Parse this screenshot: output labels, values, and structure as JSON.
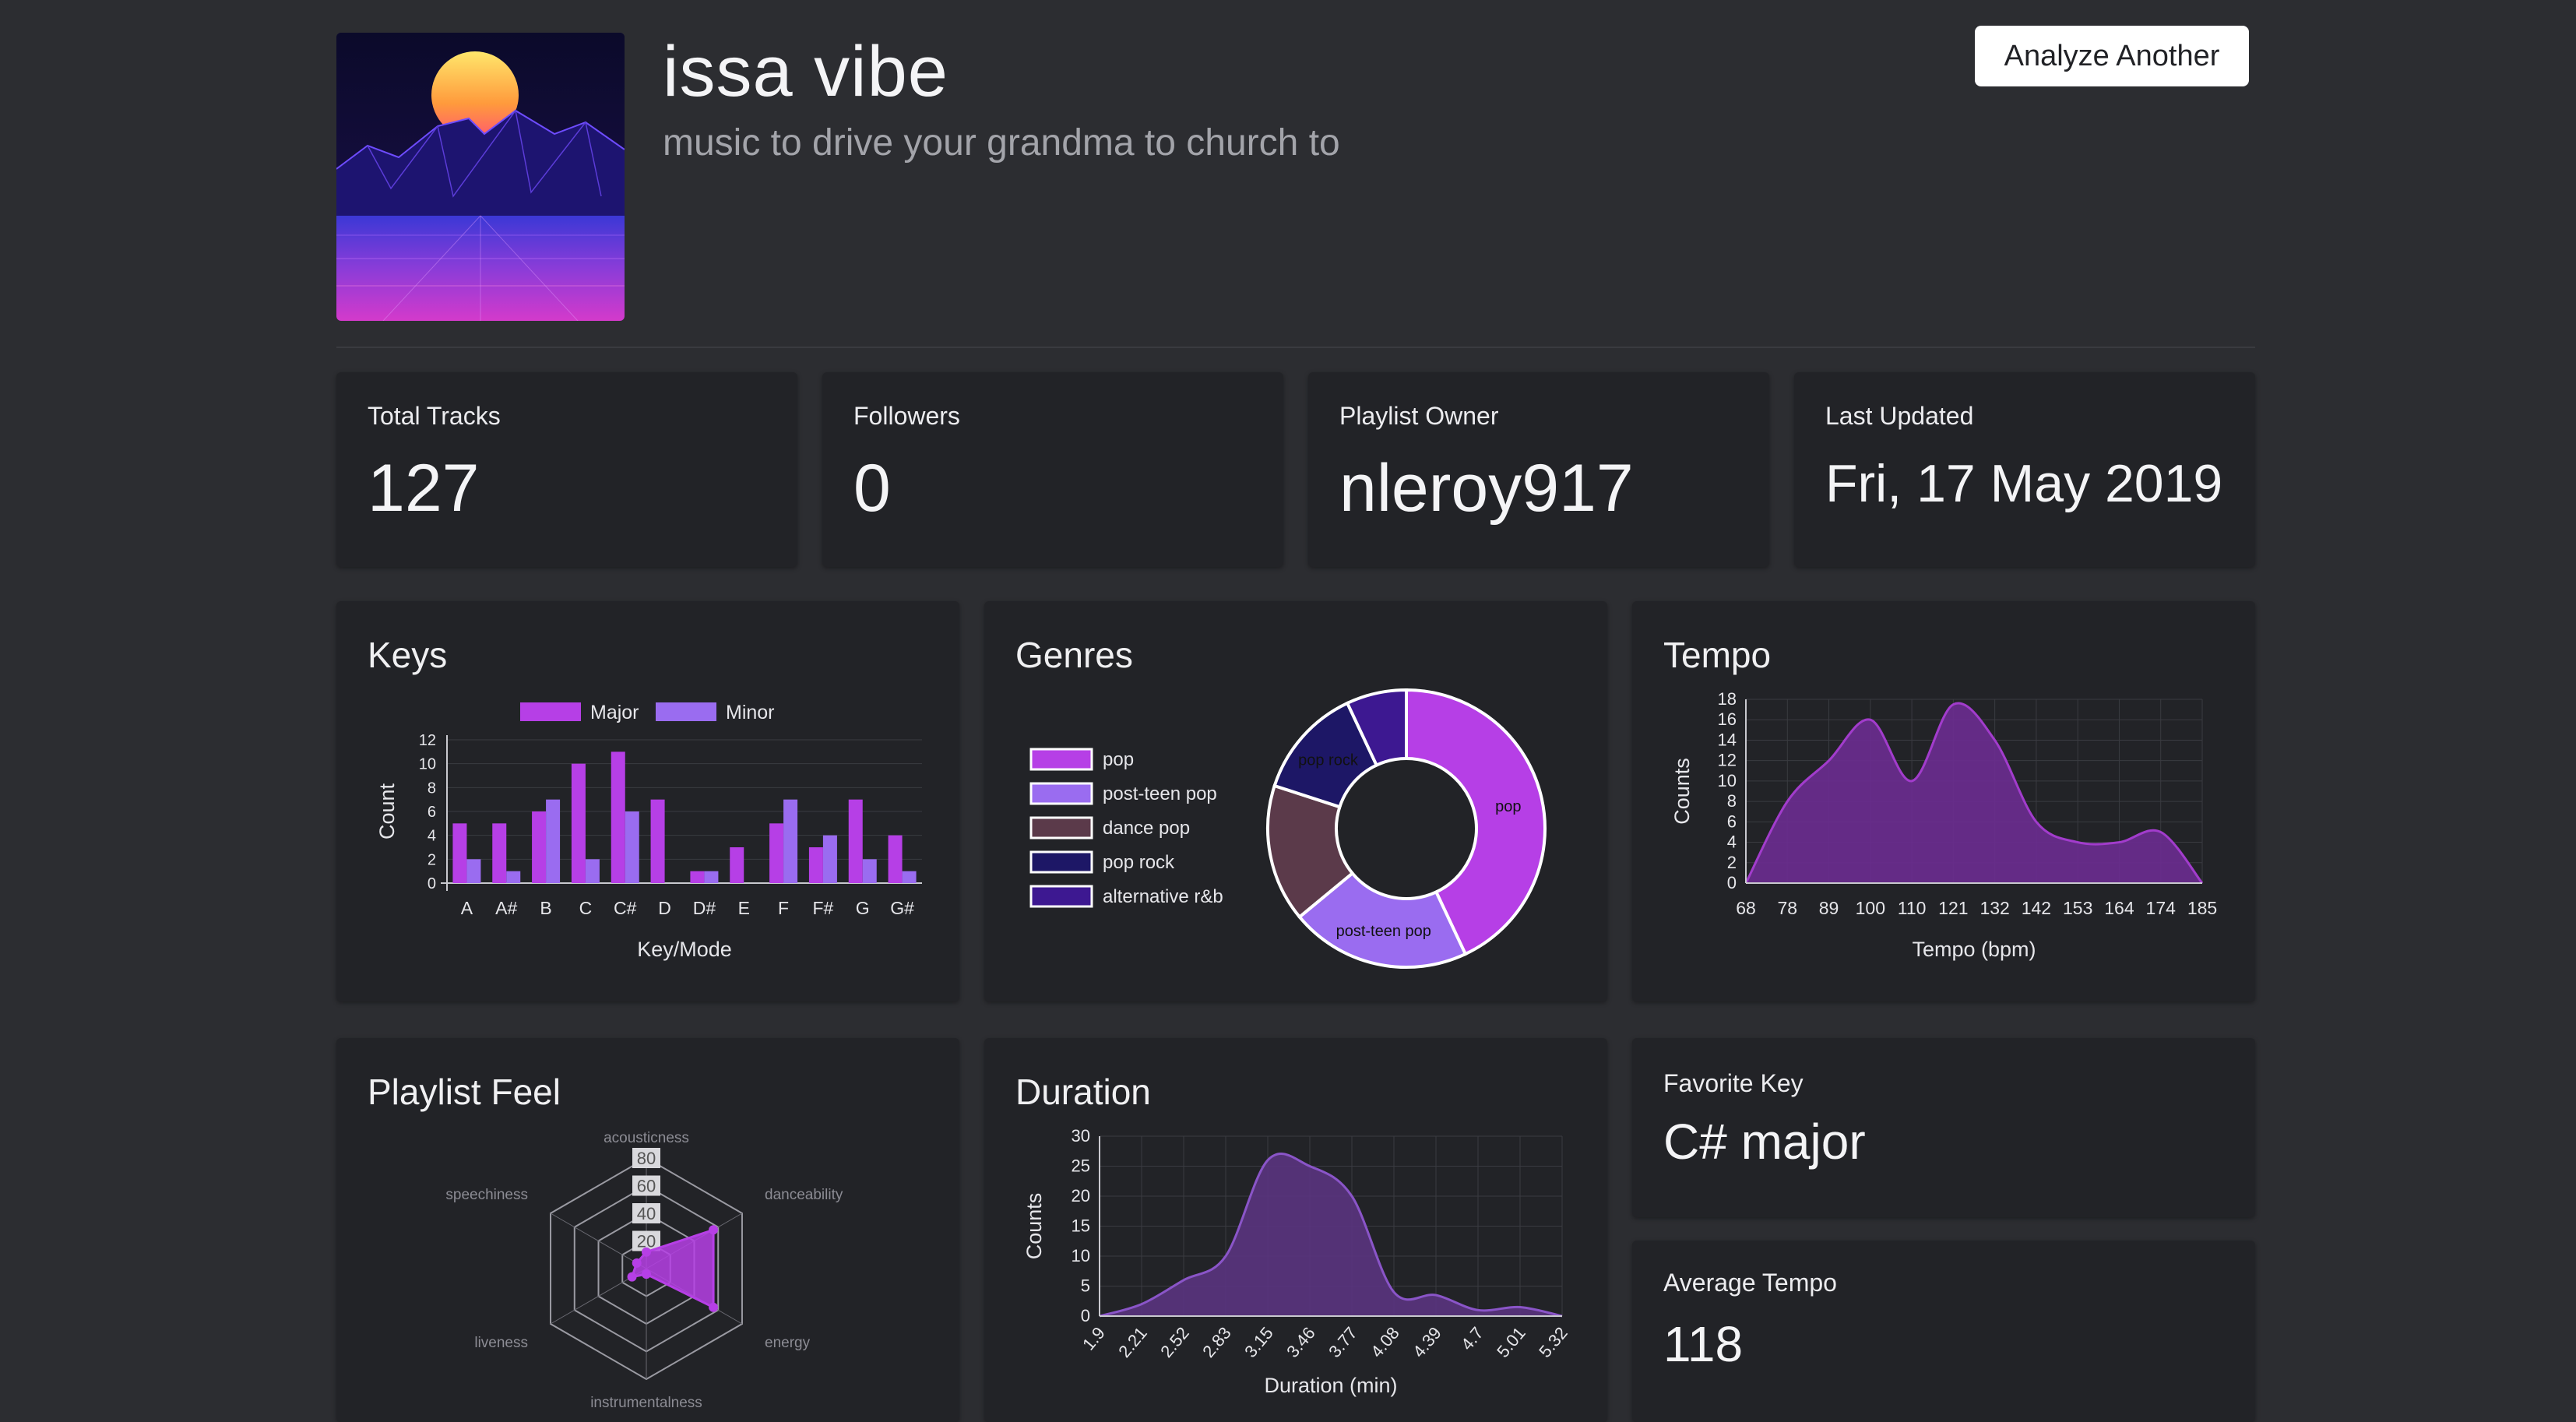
{
  "playlist": {
    "title": "issa vibe",
    "description": "music to drive your grandma to church to"
  },
  "header": {
    "analyze_label": "Analyze Another"
  },
  "stats": [
    {
      "label": "Total Tracks",
      "value": "127"
    },
    {
      "label": "Followers",
      "value": "0"
    },
    {
      "label": "Playlist Owner",
      "value": "nleroy917"
    },
    {
      "label": "Last Updated",
      "value": "Fri, 17 May 2019"
    }
  ],
  "cards": {
    "keys_title": "Keys",
    "genres_title": "Genres",
    "tempo_title": "Tempo",
    "feel_title": "Playlist Feel",
    "duration_title": "Duration"
  },
  "favorite_key": {
    "label": "Favorite Key",
    "value": "C# major"
  },
  "average_tempo": {
    "label": "Average Tempo",
    "value": "118"
  },
  "colors": {
    "major": "#b63fe6",
    "minor": "#9a6cf0",
    "area": "#6c2c91",
    "area_line": "#a23ccc",
    "duration_area": "#5a347f",
    "duration_line": "#8a55c8",
    "pop": "#b63fe6",
    "post_teen_pop": "#9a6cf0",
    "dance_pop": "#5b3a4a",
    "pop_rock": "#1d1766",
    "alt_rnb": "#3d1891"
  },
  "chart_data": [
    {
      "id": "keys",
      "type": "bar",
      "categories": [
        "A",
        "A#",
        "B",
        "C",
        "C#",
        "D",
        "D#",
        "E",
        "F",
        "F#",
        "G",
        "G#"
      ],
      "series": [
        {
          "name": "Major",
          "values": [
            5,
            5,
            6,
            10,
            11,
            7,
            1,
            3,
            5,
            3,
            7,
            4
          ]
        },
        {
          "name": "Minor",
          "values": [
            2,
            1,
            7,
            2,
            6,
            0,
            1,
            0,
            7,
            4,
            2,
            1
          ]
        }
      ],
      "xlabel": "Key/Mode",
      "ylabel": "Count",
      "ylim": [
        0,
        12
      ],
      "yticks": [
        0,
        2,
        4,
        6,
        8,
        10,
        12
      ],
      "legend": "top"
    },
    {
      "id": "genres",
      "type": "pie",
      "labels": [
        "pop",
        "post-teen pop",
        "dance pop",
        "pop rock",
        "alternative r&b"
      ],
      "values": [
        43,
        21,
        16,
        13,
        7
      ],
      "slice_labels": [
        "pop",
        "post-teen pop",
        "",
        "pop rock",
        ""
      ],
      "legend": "left"
    },
    {
      "id": "tempo",
      "type": "area",
      "x": [
        68,
        78,
        89,
        100,
        110,
        121,
        132,
        142,
        153,
        164,
        174,
        185
      ],
      "x_tick_labels": [
        "68",
        "78",
        "89",
        "100",
        "110",
        "121",
        "132",
        "142",
        "153",
        "164",
        "174",
        "185"
      ],
      "y": [
        0,
        8,
        12,
        16,
        10,
        17.5,
        14,
        6,
        4,
        4,
        5,
        0
      ],
      "xlabel": "Tempo (bpm)",
      "ylabel": "Counts",
      "ylim": [
        0,
        18
      ],
      "yticks": [
        0,
        2,
        4,
        6,
        8,
        10,
        12,
        14,
        16,
        18
      ]
    },
    {
      "id": "feel",
      "type": "radar",
      "axes": [
        "acousticness",
        "danceability",
        "energy",
        "instrumentalness",
        "liveness",
        "speechiness"
      ],
      "values": [
        15,
        70,
        70,
        5,
        15,
        10
      ],
      "rlim": [
        0,
        100
      ],
      "rticks": [
        "20",
        "40",
        "60",
        "80"
      ]
    },
    {
      "id": "duration",
      "type": "area",
      "x": [
        1.9,
        2.21,
        2.52,
        2.83,
        3.15,
        3.46,
        3.77,
        4.08,
        4.39,
        4.7,
        5.01,
        5.32
      ],
      "x_tick_labels": [
        "1.9",
        "2.21",
        "2.52",
        "2.83",
        "3.15",
        "3.46",
        "3.77",
        "4.08",
        "4.39",
        "4.7",
        "5.01",
        "5.32"
      ],
      "y": [
        0,
        2,
        6,
        10,
        26,
        25,
        20,
        4,
        3.5,
        1,
        1.5,
        0
      ],
      "xlabel": "Duration (min)",
      "ylabel": "Counts",
      "ylim": [
        0,
        30
      ],
      "yticks": [
        0,
        5,
        10,
        15,
        20,
        25,
        30
      ]
    }
  ]
}
